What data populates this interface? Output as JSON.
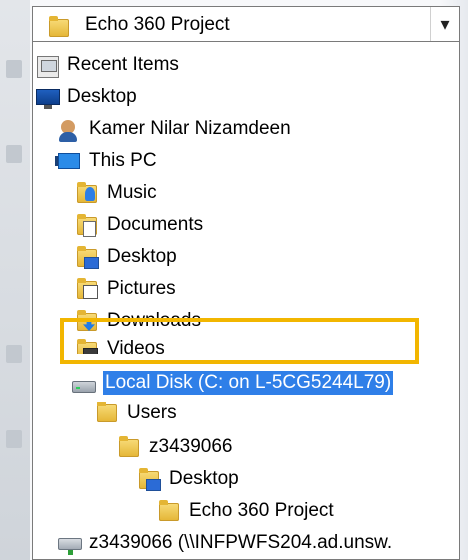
{
  "combo": {
    "selected_label": "Echo 360 Project",
    "arrow": "▾"
  },
  "tree_items": [
    {
      "label": "Recent Items",
      "icon": "recent-items-icon",
      "selected": false
    },
    {
      "label": "Desktop",
      "icon": "desktop-monitor-icon",
      "selected": false
    },
    {
      "label": "Kamer Nilar Nizamdeen",
      "icon": "user-folder-icon",
      "selected": false
    },
    {
      "label": "This PC",
      "icon": "this-pc-icon",
      "selected": false
    },
    {
      "label": "Music",
      "icon": "music-folder-icon",
      "selected": false
    },
    {
      "label": "Documents",
      "icon": "documents-folder-icon",
      "selected": false
    },
    {
      "label": "Desktop",
      "icon": "desktop-folder-icon",
      "selected": false
    },
    {
      "label": "Pictures",
      "icon": "pictures-folder-icon",
      "selected": false
    },
    {
      "label": "Downloads",
      "icon": "downloads-folder-icon",
      "selected": false
    },
    {
      "label": "Videos",
      "icon": "videos-folder-icon",
      "selected": false
    },
    {
      "label": "Local Disk (C: on L-5CG5244L79)",
      "icon": "local-disk-icon",
      "selected": true
    },
    {
      "label": "Users",
      "icon": "folder-icon",
      "selected": false
    },
    {
      "label": "z3439066",
      "icon": "folder-icon",
      "selected": false
    },
    {
      "label": "Desktop",
      "icon": "desktop-folder-icon",
      "selected": false
    },
    {
      "label": "Echo 360 Project",
      "icon": "folder-icon",
      "selected": false
    },
    {
      "label": "z3439066 (\\\\INFPWFS204.ad.unsw.",
      "icon": "network-drive-icon",
      "selected": false
    }
  ],
  "colors": {
    "selection_blue": "#2f7fe8",
    "highlight_yellow": "#f2b600"
  }
}
